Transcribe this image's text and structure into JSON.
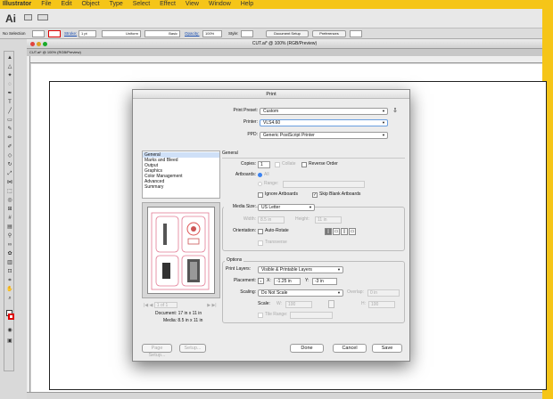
{
  "menubar": {
    "items": [
      "Illustrator",
      "File",
      "Edit",
      "Object",
      "Type",
      "Select",
      "Effect",
      "View",
      "Window",
      "Help"
    ]
  },
  "appbar": {
    "logo": "Ai"
  },
  "control_bar": {
    "selection": "No Selection",
    "stroke_label": "Stroke:",
    "stroke_value": "1 pt",
    "profile": "Uniform",
    "brush": "Basic",
    "opacity_label": "Opacity:",
    "opacity_value": "100%",
    "style_label": "Style:",
    "document_setup": "Document Setup",
    "preferences": "Preferences"
  },
  "document": {
    "window_title": "CUT.ai* @ 100% (RGB/Preview)",
    "tab_title": "CUT.ai* @ 100% (RGB/Preview)"
  },
  "print_dialog": {
    "title": "Print",
    "print_preset_label": "Print Preset:",
    "print_preset": "Custom",
    "printer_label": "Printer:",
    "printer": "VLS4.60",
    "ppd_label": "PPD:",
    "ppd": "Generic PostScript Printer",
    "categories": [
      "General",
      "Marks and Bleed",
      "Output",
      "Graphics",
      "Color Management",
      "Advanced",
      "Summary"
    ],
    "selected_category": "General",
    "section_general": "General",
    "copies_label": "Copies:",
    "copies": "1",
    "collate": "Collate",
    "reverse_order": "Reverse Order",
    "artboards_label": "Artboards:",
    "all": "All",
    "range": "Range:",
    "ignore_artboards": "Ignore Artboards",
    "skip_blank": "Skip Blank Artboards",
    "media_size_label": "Media Size:",
    "media_size": "US Letter",
    "width_label": "Width:",
    "width": "8.5 in",
    "height_label": "Height:",
    "height": "11 in",
    "orientation_label": "Orientation:",
    "auto_rotate": "Auto-Rotate",
    "transverse": "Transverse",
    "options_title": "Options",
    "print_layers_label": "Print Layers:",
    "print_layers": "Visible & Printable Layers",
    "placement_label": "Placement:",
    "x_label": "X:",
    "x": "-1.25 in",
    "y_label": "Y:",
    "y": "-3 in",
    "scaling_label": "Scaling:",
    "scaling": "Do Not Scale",
    "overlap_label": "Overlap:",
    "overlap": "0 in",
    "scale_label": "Scale:",
    "scale_w_label": "W:",
    "scale_w": "100",
    "scale_h_label": "H:",
    "scale_h": "100",
    "tile_range": "Tile Range:",
    "pager": "1 of 1",
    "document_info": "Document: 17 in x 11 in",
    "media_info": "Media: 8.5 in x 11 in",
    "page_setup": "Page Setup...",
    "setup": "Setup...",
    "done": "Done",
    "cancel": "Cancel",
    "save": "Save"
  }
}
